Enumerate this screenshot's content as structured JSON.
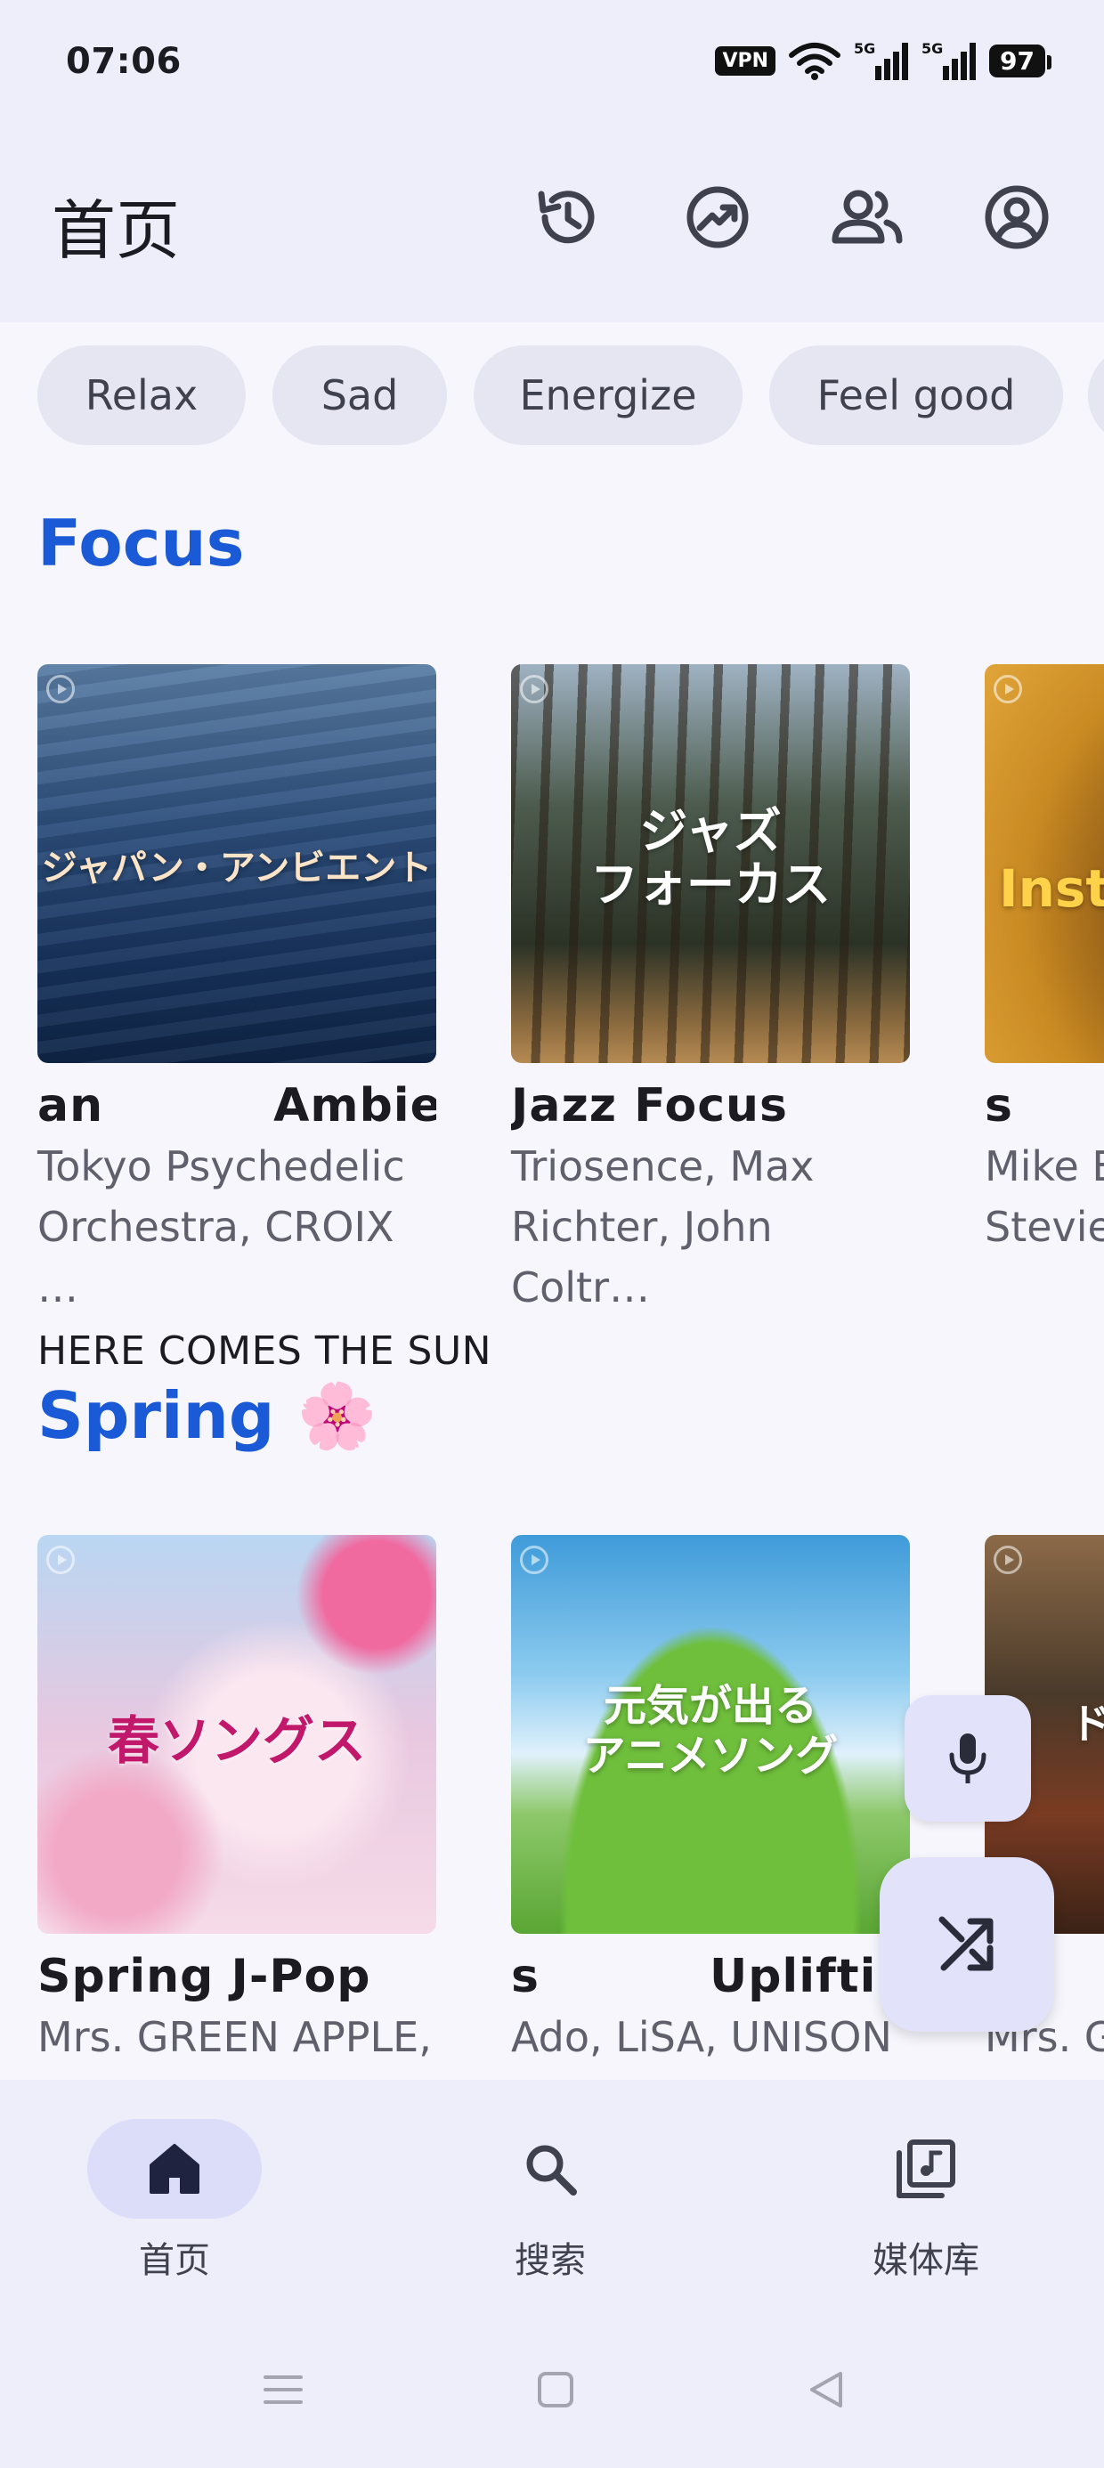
{
  "status_bar": {
    "time": "07:06",
    "vpn_label": "VPN",
    "network_1": "5G",
    "network_2": "5G",
    "battery": "97"
  },
  "header": {
    "title": "首页",
    "actions": [
      "history-icon",
      "trending-icon",
      "people-icon",
      "account-icon"
    ]
  },
  "mood_chips": [
    "Relax",
    "Sad",
    "Energize",
    "Feel good"
  ],
  "sections": {
    "focus": {
      "title": "Focus",
      "cards": [
        {
          "cover_text": "ジャパン・アンビエント",
          "title": "an          Ambient",
          "subtitle_1": "Tokyo Psychedelic",
          "subtitle_2": "Orchestra, CROIX …"
        },
        {
          "cover_text_1": "ジャズ",
          "cover_text_2": "フォーカス",
          "title": "Jazz Focus",
          "subtitle_1": "Triosence, Max",
          "subtitle_2": "Richter, John Coltr…"
        },
        {
          "cover_text": "Instr",
          "title": "s",
          "subtitle_1": "Mike E",
          "subtitle_2": "Stevie"
        }
      ]
    },
    "spring": {
      "kicker": "HERE COMES THE SUN",
      "title": "Spring 🌸",
      "cards": [
        {
          "cover_text": "春ソングス",
          "title": "Spring J-Pop",
          "subtitle_1": "Mrs. GREEN APPLE,"
        },
        {
          "cover_text_1": "元気が出る",
          "cover_text_2": "アニメソング",
          "title": "s          Uplifting",
          "subtitle_1": "Ado, LiSA, UNISON"
        },
        {
          "cover_text": "ド",
          "title": "rp",
          "subtitle_1": "Mrs. G"
        }
      ]
    }
  },
  "bottom_nav": [
    {
      "label": "首页",
      "icon": "home-icon",
      "active": true
    },
    {
      "label": "搜索",
      "icon": "search-icon",
      "active": false
    },
    {
      "label": "媒体库",
      "icon": "library-icon",
      "active": false
    }
  ],
  "colors": {
    "accent": "#1b5ad6",
    "surface": "#edeefa",
    "background": "#f7f6fd",
    "chip": "#e5e6f2",
    "fab": "#e2e2fb"
  }
}
